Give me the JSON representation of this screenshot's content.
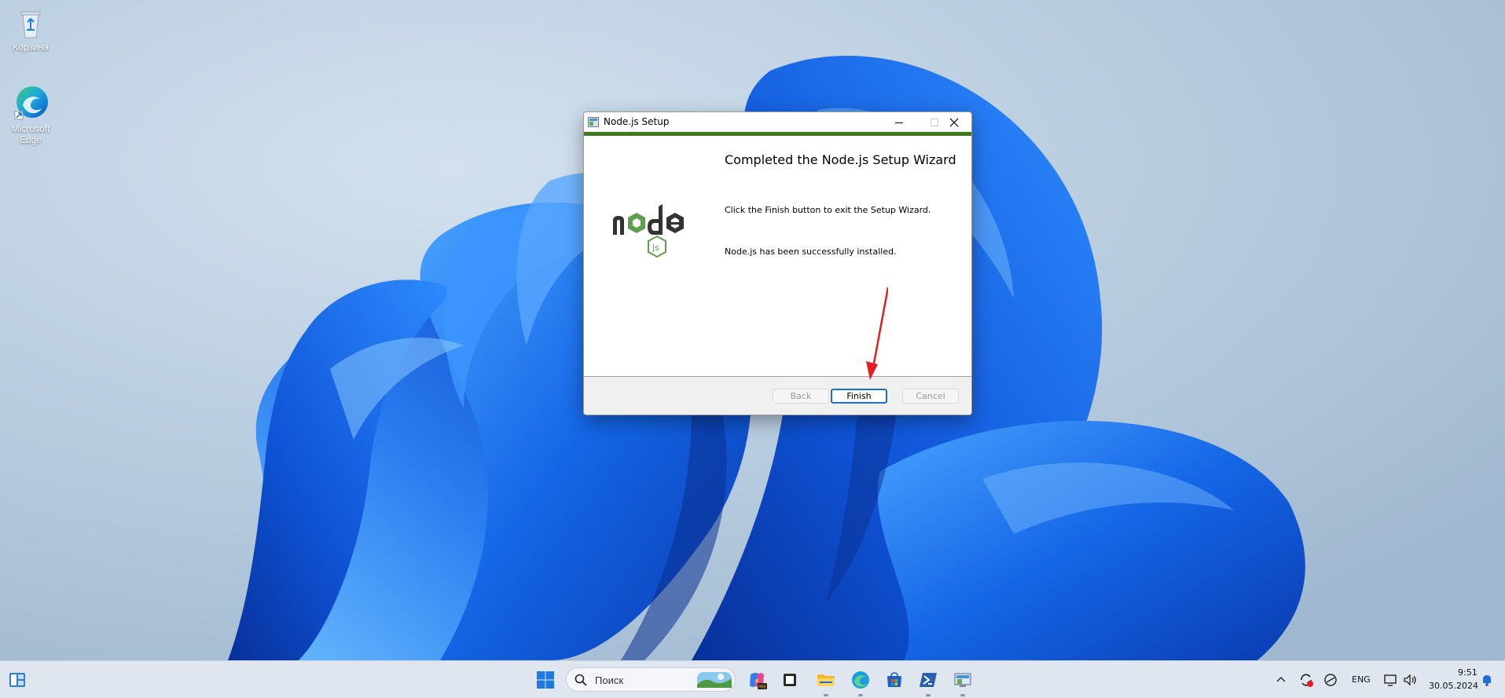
{
  "desktop": {
    "icons": [
      {
        "label": "Корзина"
      },
      {
        "label": "Microsoft Edge"
      }
    ]
  },
  "dialog": {
    "window_title": "Node.js Setup",
    "heading": "Completed the Node.js Setup Wizard",
    "line1": "Click the Finish button to exit the Setup Wizard.",
    "line2": "Node.js has been successfully installed.",
    "buttons": {
      "back": "Back",
      "finish": "Finish",
      "cancel": "Cancel"
    },
    "accent_color": "#3b7a1f"
  },
  "taskbar": {
    "search_placeholder": "Поиск",
    "language": "ENG",
    "time": "9:51",
    "date": "30.05.2024"
  },
  "colors": {
    "finish_border": "#1f6fc5",
    "arrow": "#e02020"
  }
}
